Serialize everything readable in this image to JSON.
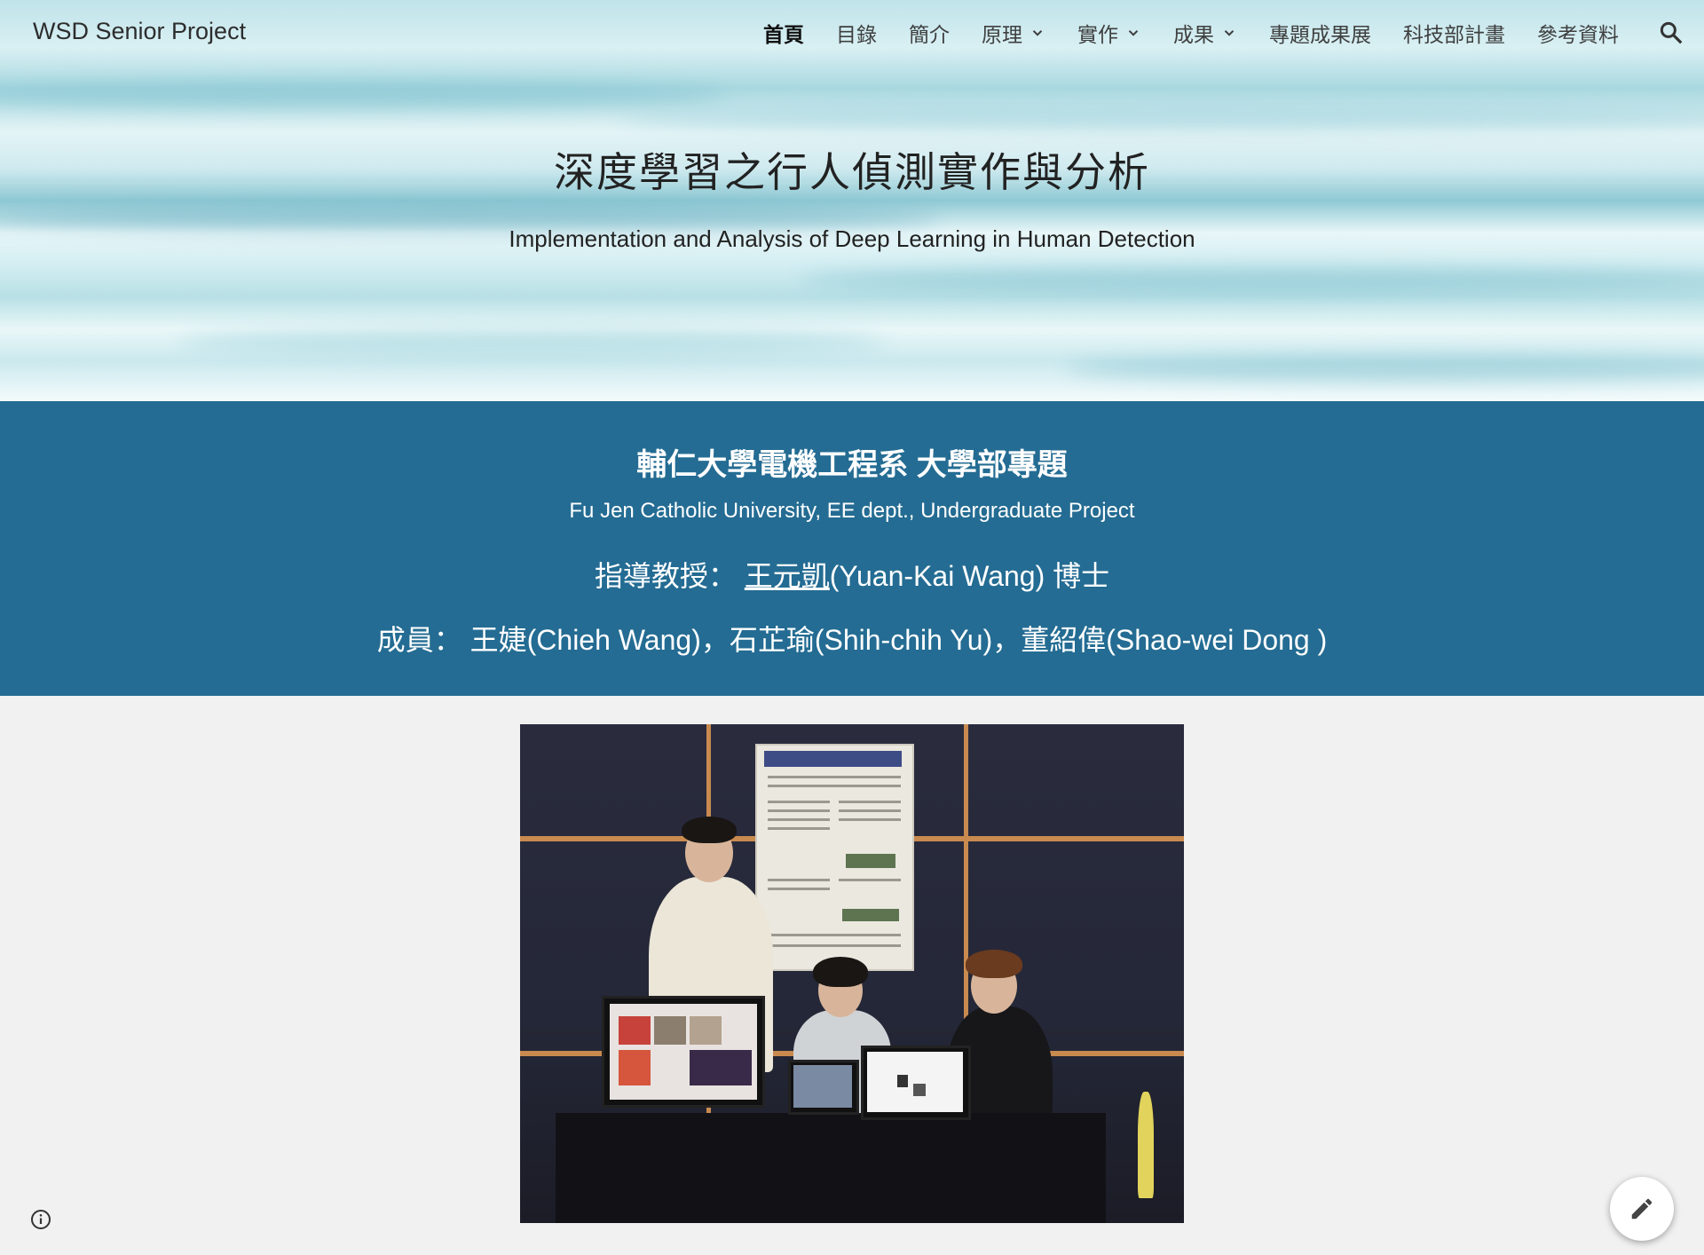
{
  "site": {
    "title": "WSD Senior Project"
  },
  "nav": {
    "items": [
      {
        "label": "首頁",
        "active": true,
        "dropdown": false
      },
      {
        "label": "目錄",
        "active": false,
        "dropdown": false
      },
      {
        "label": "簡介",
        "active": false,
        "dropdown": false
      },
      {
        "label": "原理",
        "active": false,
        "dropdown": true
      },
      {
        "label": "實作",
        "active": false,
        "dropdown": true
      },
      {
        "label": "成果",
        "active": false,
        "dropdown": true
      },
      {
        "label": "專題成果展",
        "active": false,
        "dropdown": false
      },
      {
        "label": "科技部計畫",
        "active": false,
        "dropdown": false
      },
      {
        "label": "參考資料",
        "active": false,
        "dropdown": false
      }
    ],
    "search_icon": "search-icon"
  },
  "hero": {
    "title": "深度學習之行人偵測實作與分析",
    "subtitle": "Implementation and Analysis of Deep Learning in Human Detection"
  },
  "band": {
    "title": "輔仁大學電機工程系 大學部專題",
    "subtitle": "Fu Jen Catholic University, EE dept., Undergraduate Project",
    "advisor_prefix": "指導教授：",
    "advisor_link": "王元凱",
    "advisor_suffix": "(Yuan-Kai Wang) 博士",
    "members": "成員： 王婕(Chieh Wang)，石芷瑜(Shih-chih Yu)，董紹偉(Shao-wei Dong )"
  },
  "colors": {
    "band_bg": "#246c93",
    "page_bg": "#f1f1f1",
    "text_dark": "#222222"
  },
  "floating": {
    "info_icon": "info-icon",
    "edit_icon": "pencil-icon"
  }
}
